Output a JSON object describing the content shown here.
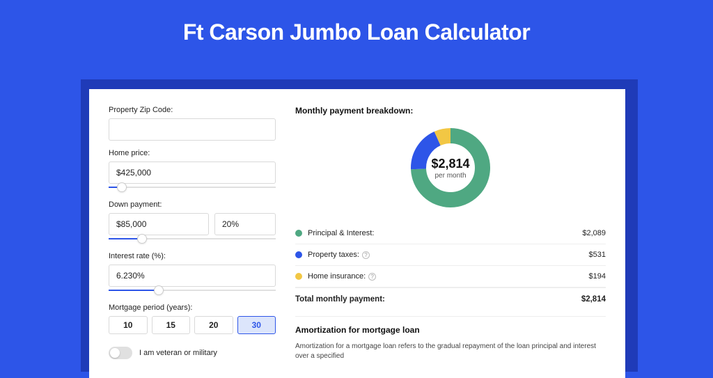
{
  "page_title": "Ft Carson Jumbo Loan Calculator",
  "form": {
    "zip_label": "Property Zip Code:",
    "zip_value": "",
    "home_price_label": "Home price:",
    "home_price_value": "$425,000",
    "home_price_slider_pct": 8,
    "down_payment_label": "Down payment:",
    "down_payment_value": "$85,000",
    "down_payment_pct_value": "20%",
    "down_payment_slider_pct": 20,
    "interest_label": "Interest rate (%):",
    "interest_value": "6.230%",
    "interest_slider_pct": 30,
    "period_label": "Mortgage period (years):",
    "periods": [
      "10",
      "15",
      "20",
      "30"
    ],
    "period_selected": "30",
    "veteran_label": "I am veteran or military",
    "veteran_on": false
  },
  "breakdown": {
    "title": "Monthly payment breakdown:",
    "donut_amount": "$2,814",
    "donut_sub": "per month",
    "items": [
      {
        "label": "Principal & Interest:",
        "value": "$2,089",
        "color": "#4fa882",
        "info": false
      },
      {
        "label": "Property taxes:",
        "value": "$531",
        "color": "#2d55e8",
        "info": true
      },
      {
        "label": "Home insurance:",
        "value": "$194",
        "color": "#f2c744",
        "info": true
      }
    ],
    "total_label": "Total monthly payment:",
    "total_value": "$2,814"
  },
  "amortization": {
    "title": "Amortization for mortgage loan",
    "text": "Amortization for a mortgage loan refers to the gradual repayment of the loan principal and interest over a specified"
  },
  "chart_data": {
    "type": "pie",
    "title": "Monthly payment breakdown",
    "series": [
      {
        "name": "Principal & Interest",
        "value": 2089,
        "color": "#4fa882"
      },
      {
        "name": "Property taxes",
        "value": 531,
        "color": "#2d55e8"
      },
      {
        "name": "Home insurance",
        "value": 194,
        "color": "#f2c744"
      }
    ],
    "total": 2814,
    "center_label": "$2,814 per month"
  }
}
